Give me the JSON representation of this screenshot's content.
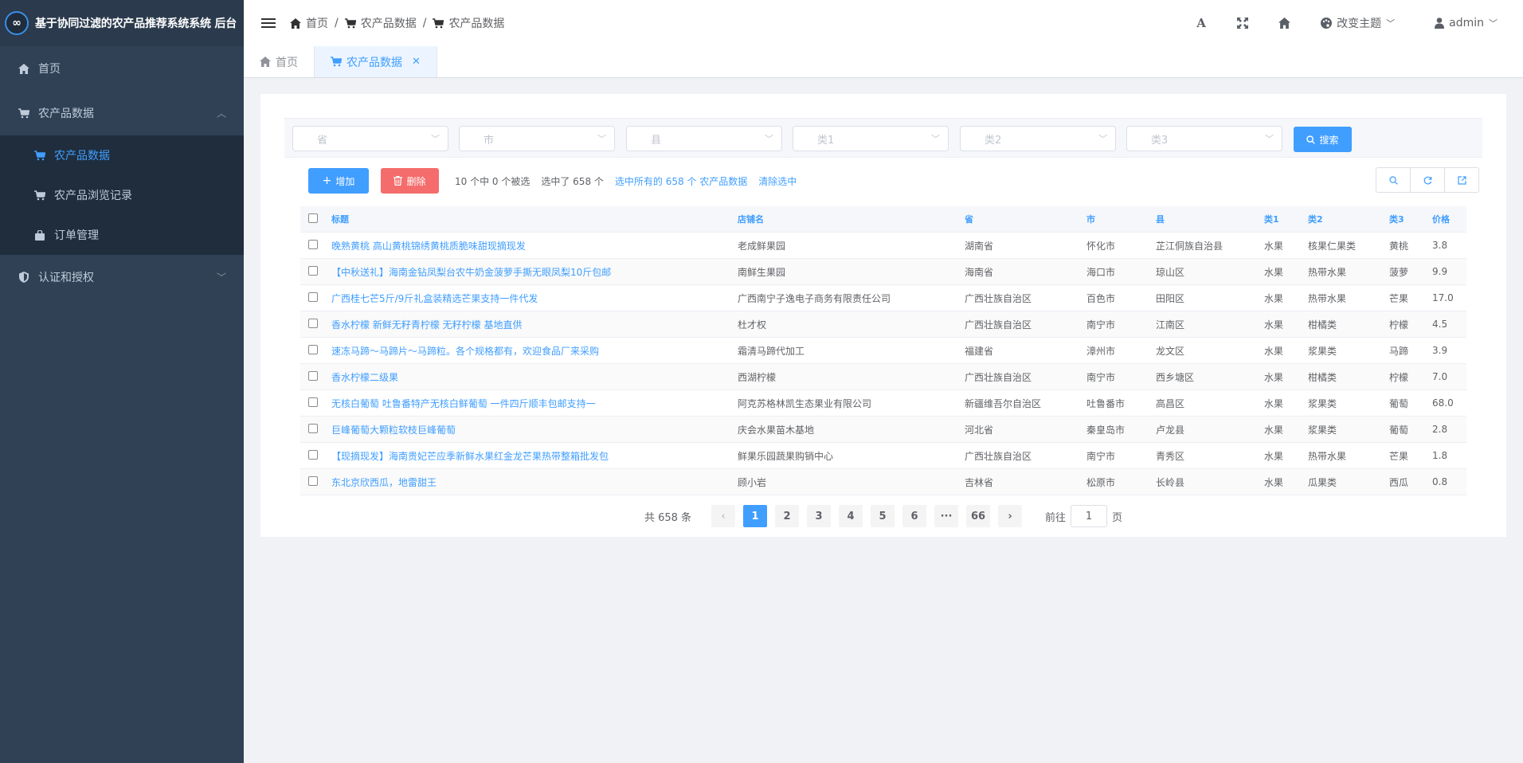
{
  "app": {
    "title": "基于协同过滤的农产品推荐系统系统 后台",
    "logo_glyph": "∞"
  },
  "sidebar": {
    "items": [
      {
        "label": "首页",
        "icon": "home-icon"
      },
      {
        "label": "农产品数据",
        "icon": "cart-icon",
        "expanded": true,
        "children": [
          {
            "label": "农产品数据",
            "icon": "cart-icon",
            "active": true
          },
          {
            "label": "农产品浏览记录",
            "icon": "cart-icon"
          },
          {
            "label": "订单管理",
            "icon": "bag-icon"
          }
        ]
      },
      {
        "label": "认证和授权",
        "icon": "shield-icon",
        "expanded": false
      }
    ]
  },
  "breadcrumb": [
    "首页",
    "农产品数据",
    "农产品数据"
  ],
  "header": {
    "theme_label": "改变主题",
    "user_label": "admin"
  },
  "tags": [
    {
      "label": "首页"
    },
    {
      "label": "农产品数据",
      "active": true
    }
  ],
  "filters": {
    "province": "省",
    "city": "市",
    "county": "县",
    "cat1": "类1",
    "cat2": "类2",
    "cat3": "类3",
    "search_label": "搜索"
  },
  "toolbar": {
    "add_label": "增加",
    "delete_label": "删除",
    "selected_text": "10 个中 0 个被选",
    "selected_total": "选中了 658 个",
    "select_all_link": "选中所有的 658 个 农产品数据",
    "clear_link": "清除选中"
  },
  "table": {
    "headers": [
      "标题",
      "店铺名",
      "省",
      "市",
      "县",
      "类1",
      "类2",
      "类3",
      "价格"
    ],
    "rows": [
      [
        "晚熟黄桃 高山黄桃锦绣黄桃质脆味甜现摘现发",
        "老成鲜果园",
        "湖南省",
        "怀化市",
        "芷江侗族自治县",
        "水果",
        "核果仁果类",
        "黄桃",
        "3.8"
      ],
      [
        "【中秋送礼】海南金钻凤梨台农牛奶金菠萝手撕无眼凤梨10斤包邮",
        "南鲜生果园",
        "海南省",
        "海口市",
        "琼山区",
        "水果",
        "热带水果",
        "菠萝",
        "9.9"
      ],
      [
        "广西桂七芒5斤/9斤礼盒装精选芒果支持一件代发",
        "广西南宁子逸电子商务有限责任公司",
        "广西壮族自治区",
        "百色市",
        "田阳区",
        "水果",
        "热带水果",
        "芒果",
        "17.0"
      ],
      [
        "香水柠檬 新鲜无籽青柠檬 无籽柠檬 基地直供",
        "杜才权",
        "广西壮族自治区",
        "南宁市",
        "江南区",
        "水果",
        "柑橘类",
        "柠檬",
        "4.5"
      ],
      [
        "速冻马蹄～马蹄片～马蹄粒。各个规格都有，欢迎食品厂来采购",
        "霜清马蹄代加工",
        "福建省",
        "漳州市",
        "龙文区",
        "水果",
        "浆果类",
        "马蹄",
        "3.9"
      ],
      [
        "香水柠檬二级果",
        "西湖柠檬",
        "广西壮族自治区",
        "南宁市",
        "西乡塘区",
        "水果",
        "柑橘类",
        "柠檬",
        "7.0"
      ],
      [
        "无核白葡萄 吐鲁番特产无核白鲜葡萄 一件四斤顺丰包邮支持一",
        "阿克苏格林凯生态果业有限公司",
        "新疆维吾尔自治区",
        "吐鲁番市",
        "高昌区",
        "水果",
        "浆果类",
        "葡萄",
        "68.0"
      ],
      [
        "巨峰葡萄大颗粒软枝巨峰葡萄",
        "庆会水果苗木基地",
        "河北省",
        "秦皇岛市",
        "卢龙县",
        "水果",
        "浆果类",
        "葡萄",
        "2.8"
      ],
      [
        "【现摘现发】海南贵妃芒应季新鲜水果红金龙芒果热带整箱批发包",
        "鲜果乐园蔬果购销中心",
        "广西壮族自治区",
        "南宁市",
        "青秀区",
        "水果",
        "热带水果",
        "芒果",
        "1.8"
      ],
      [
        "东北京欣西瓜，地雷甜王",
        "顾小岩",
        "吉林省",
        "松原市",
        "长岭县",
        "水果",
        "瓜果类",
        "西瓜",
        "0.8"
      ]
    ]
  },
  "pagination": {
    "total_label": "共 658 条",
    "pages": [
      "1",
      "2",
      "3",
      "4",
      "5",
      "6",
      "···",
      "66"
    ],
    "current": "1",
    "goto_label": "前往",
    "goto_value": "1",
    "page_suffix": "页"
  },
  "colors": {
    "sidebar_bg": "#304156",
    "accent": "#409eff",
    "danger": "#f56c6c"
  }
}
